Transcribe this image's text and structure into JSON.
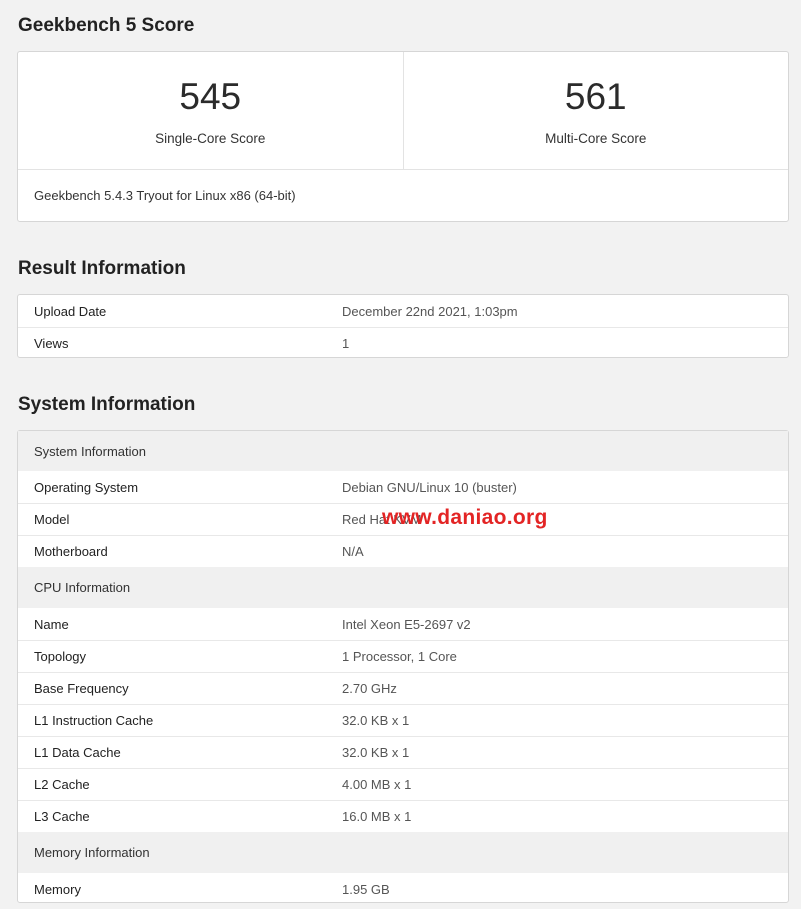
{
  "score_section": {
    "title": "Geekbench 5 Score",
    "single_core": {
      "value": "545",
      "label": "Single-Core Score"
    },
    "multi_core": {
      "value": "561",
      "label": "Multi-Core Score"
    },
    "footer": "Geekbench 5.4.3 Tryout for Linux x86 (64-bit)"
  },
  "result_section": {
    "title": "Result Information",
    "rows": [
      {
        "key": "Upload Date",
        "value": "December 22nd 2021, 1:03pm"
      },
      {
        "key": "Views",
        "value": "1"
      }
    ]
  },
  "system_section": {
    "title": "System Information",
    "groups": [
      {
        "heading": "System Information",
        "rows": [
          {
            "key": "Operating System",
            "value": "Debian GNU/Linux 10 (buster)"
          },
          {
            "key": "Model",
            "value": "Red Hat KVM"
          },
          {
            "key": "Motherboard",
            "value": "N/A"
          }
        ]
      },
      {
        "heading": "CPU Information",
        "rows": [
          {
            "key": "Name",
            "value": "Intel Xeon E5-2697 v2"
          },
          {
            "key": "Topology",
            "value": "1 Processor, 1 Core"
          },
          {
            "key": "Base Frequency",
            "value": "2.70 GHz"
          },
          {
            "key": "L1 Instruction Cache",
            "value": "32.0 KB x 1"
          },
          {
            "key": "L1 Data Cache",
            "value": "32.0 KB x 1"
          },
          {
            "key": "L2 Cache",
            "value": "4.00 MB x 1"
          },
          {
            "key": "L3 Cache",
            "value": "16.0 MB x 1"
          }
        ]
      },
      {
        "heading": "Memory Information",
        "rows": [
          {
            "key": "Memory",
            "value": "1.95 GB"
          }
        ]
      }
    ]
  },
  "watermark": {
    "text": "www.daniao.org",
    "color": "#e32424"
  }
}
